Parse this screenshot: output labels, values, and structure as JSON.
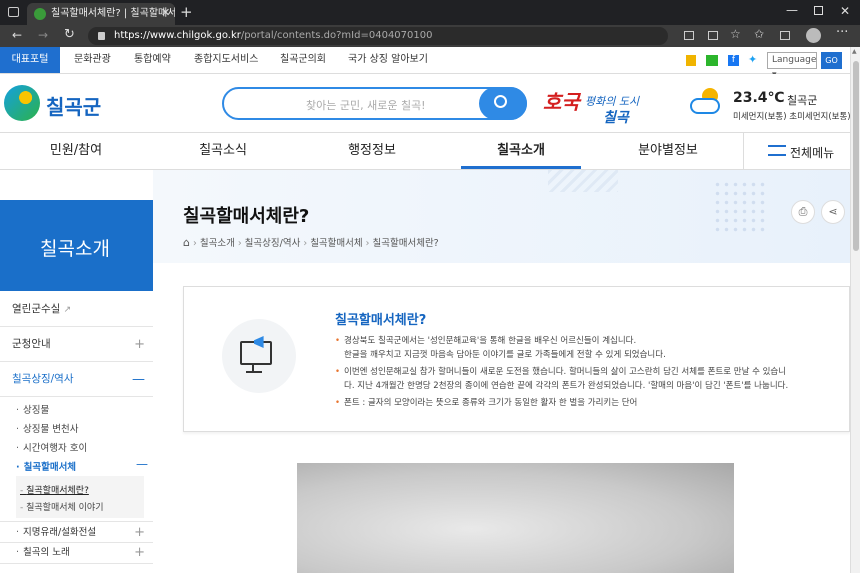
{
  "browser": {
    "tab_title": "칠곡할매서체란? | 칠곡할매서체",
    "url_main": "https://www.chilgok.go.kr",
    "url_rest": "/portal/contents.do?mId=0404070100"
  },
  "util": {
    "items": [
      "대표포털",
      "문화관광",
      "통합예약",
      "종합지도서비스",
      "칠곡군의회",
      "국가 상징 알아보기"
    ],
    "language": "Language",
    "go": "GO"
  },
  "header": {
    "logo_text": "칠곡군",
    "search_placeholder": "찾아는 군민, 새로운 칠곡!",
    "slogan_line1": "평화의 도시",
    "slogan_line2": "칠곡",
    "weather_temp": "23.4℃",
    "weather_place": "칠곡군",
    "dust": "미세먼지(보통) 초미세먼지(보통)"
  },
  "gnb": {
    "items": [
      "민원/참여",
      "칠곡소식",
      "행정정보",
      "칠곡소개",
      "분야별정보"
    ],
    "all_menu": "전체메뉴"
  },
  "sidebar": {
    "title": "칠곡소개",
    "rows": [
      "열린군수실",
      "군청안내",
      "칠곡상징/역사"
    ],
    "subs": [
      "상징물",
      "상징물 변천사",
      "시간여행자 호이",
      "칠곡할매서체"
    ],
    "subsubs": [
      "칠곡할매서체란?",
      "칠곡할매서체 이야기"
    ],
    "more": [
      "지명유래/설화전설",
      "칠곡의 노래"
    ]
  },
  "page": {
    "title": "칠곡할매서체란?",
    "breadcrumb": [
      "칠곡소개",
      "칠곡상징/역사",
      "칠곡할매서체",
      "칠곡할매서체란?"
    ]
  },
  "info": {
    "title": "칠곡할매서체란?",
    "p1a": "경상북도 칠곡군에서는 '성인문해교육'을 통해 한글을 배우신 어르신들이 계십니다.",
    "p1b": "한글을 깨우치고 지금껏 마음속 담아둔 이야기를 글로 가족들에게 전할 수 있게 되었습니다.",
    "p2a": "이번엔 성인문해교실 참가 할머니들이 새로운 도전을 했습니다. 할머니들의 삶이 고스란히 담긴 서체를 폰트로 만날 수 있습니",
    "p2b": "다. 지난 4개월간 한명당 2천장의 종이에 연습한 끝에 각각의 폰트가 완성되었습니다. '할매의 마음'이 담긴 '폰트'를 나눕니다.",
    "p3": "폰트 : 글자의 모양이라는 뜻으로 종류와 크기가 동일한 활자 한 벌을 가리키는 단어"
  },
  "colors": {
    "primary": "#1f6fcf",
    "search": "#2f8ae5",
    "sidebar_active": "#1a6fc9",
    "accent": "#e8752f"
  }
}
